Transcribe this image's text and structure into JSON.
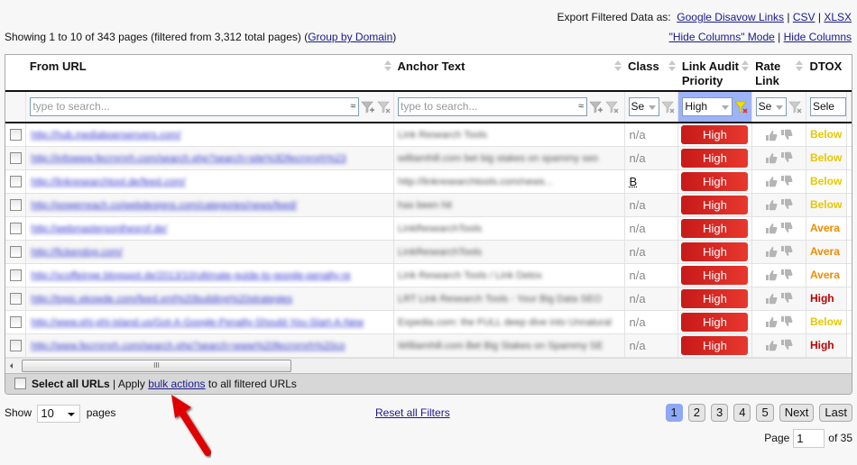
{
  "export": {
    "label": "Export Filtered Data as:",
    "links": [
      "Google Disavow Links",
      "CSV",
      "XLSX"
    ],
    "separator": "|"
  },
  "columns_links": [
    "\"Hide Columns\" Mode",
    "Hide Columns"
  ],
  "showing": {
    "text": "Showing 1 to 10 of 343 pages (filtered from 3,312 total pages) (",
    "group_link": "Group by Domain",
    "close": ")"
  },
  "table": {
    "headers": [
      "From URL",
      "Anchor Text",
      "Class",
      "Link Audit Priority",
      "Rate Link",
      "DTOX"
    ],
    "filters": {
      "from_url_placeholder": "type to search...",
      "anchor_placeholder": "type to search...",
      "class_value": "Se",
      "priority_value": "High",
      "rate_value": "Se",
      "dtox_value": "Sele"
    },
    "rows": [
      {
        "url": "http://hub.mediaboersenvers.com/",
        "anchor": "Link Research Tools",
        "class": "n/a",
        "priority": "High",
        "dtox": "Below",
        "dtox_color": "#e6c700"
      },
      {
        "url": "http://infowww.fecrnrnrh.com/search.php?search=site%3Dfecrnrnrh%23",
        "anchor": "williamhill.com bet big stakes on spammy seo",
        "class": "n/a",
        "priority": "High",
        "dtox": "Below",
        "dtox_color": "#e6c700"
      },
      {
        "url": "http://linkresearchtool.de/feed.com/",
        "anchor": "http://linkresearchtools.com/news...",
        "class": "B",
        "priority": "High",
        "dtox": "Below",
        "dtox_color": "#e6c700"
      },
      {
        "url": "http://powerreach.co/webdesigns.com/categories/news/feed/",
        "anchor": "has been hit",
        "class": "n/a",
        "priority": "High",
        "dtox": "Below",
        "dtox_color": "#e6c700"
      },
      {
        "url": "http://webmastersonthesrof.de/",
        "anchor": "LinkResearchTools",
        "class": "n/a",
        "priority": "High",
        "dtox": "Avera",
        "dtox_color": "#f08c00"
      },
      {
        "url": "http://fickendog.com/",
        "anchor": "LinkResearchTools",
        "class": "n/a",
        "priority": "High",
        "dtox": "Avera",
        "dtox_color": "#f08c00"
      },
      {
        "url": "http://scoffeinge.blogspot.de/2013/10/ultimate-guide-to-google-penalty-re",
        "anchor": "Link Research Tools / Link Detox",
        "class": "n/a",
        "priority": "High",
        "dtox": "Avera",
        "dtox_color": "#f08c00"
      },
      {
        "url": "http://topic.ekowde.com/feed.xml%20building%20strategies",
        "anchor": "LRT Link Research Tools - Your Big Data SEO",
        "class": "n/a",
        "priority": "High",
        "dtox": "High",
        "dtox_color": "#c00000"
      },
      {
        "url": "http://www.phi-phi-island.us/Got-A-Google-Penalty-Should-You-Start-A-New",
        "anchor": "Expedia.com: the FULL deep dive into Unnatural",
        "class": "n/a",
        "priority": "High",
        "dtox": "Below",
        "dtox_color": "#e6c700"
      },
      {
        "url": "http://www.fecrnrnrh.com/search.php?search=www%20fecrnrnrh%20co",
        "anchor": "Williamhill.com Bet Big Stakes on Spammy SE",
        "class": "n/a",
        "priority": "High",
        "dtox": "High",
        "dtox_color": "#c00000"
      }
    ]
  },
  "scrollbar_grip": "III",
  "footer": {
    "select_all": "Select all URLs",
    "apply": " | Apply ",
    "bulk_link": "bulk actions",
    "suffix": " to all filtered URLs"
  },
  "show": {
    "prefix": "Show",
    "value": "10",
    "suffix": "pages"
  },
  "reset_link": "Reset all Filters",
  "pagination": {
    "pages": [
      "1",
      "2",
      "3",
      "4",
      "5"
    ],
    "active": "1",
    "next": "Next",
    "last": "Last",
    "page_label": "Page",
    "page_value": "1",
    "of_label": "of 35"
  },
  "colors": {
    "priority_high": "#d42222",
    "active_filter_bg": "#9db3f7",
    "link": "#1a1a8c"
  }
}
